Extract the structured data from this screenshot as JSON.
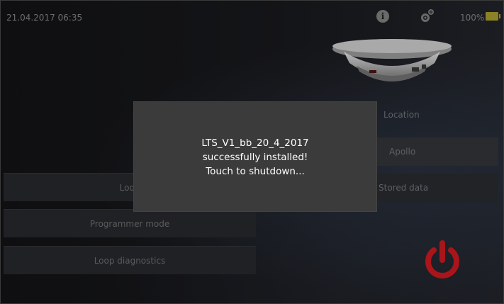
{
  "status_bar": {
    "datetime": "21.04.2017 06:35",
    "battery_percent": "100%",
    "icons": [
      "info-icon",
      "settings-gear-icon",
      "battery-icon"
    ],
    "battery_color": "#8a8224"
  },
  "menu": {
    "loop_label": "Loop",
    "programmer_mode_label": "Programmer mode",
    "loop_diagnostics_label": "Loop diagnostics"
  },
  "right_panel": {
    "location_label": "Location",
    "location_value": "Apollo",
    "stored_data_label": "Stored data"
  },
  "power_button": {
    "icon": "power-icon",
    "color": "#a8151a"
  },
  "modal": {
    "line1": "LTS_V1_bb_20_4_2017",
    "line2": "successfully installed!",
    "line3": "Touch to shutdown..."
  }
}
